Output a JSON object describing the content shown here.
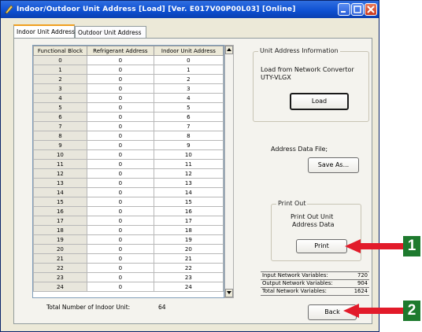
{
  "window": {
    "title": "Indoor/Outdoor Unit Address   [Load] [Ver. E017V00P00L03] [Online]"
  },
  "tabs": [
    {
      "label": "Indoor Unit Address"
    },
    {
      "label": "Outdoor Unit Address"
    }
  ],
  "table": {
    "headers": [
      "Functional Block",
      "Refrigerant Address",
      "Indoor Unit Address"
    ],
    "rows": [
      [
        "0",
        "0",
        "0"
      ],
      [
        "1",
        "0",
        "1"
      ],
      [
        "2",
        "0",
        "2"
      ],
      [
        "3",
        "0",
        "3"
      ],
      [
        "4",
        "0",
        "4"
      ],
      [
        "5",
        "0",
        "5"
      ],
      [
        "6",
        "0",
        "6"
      ],
      [
        "7",
        "0",
        "7"
      ],
      [
        "8",
        "0",
        "8"
      ],
      [
        "9",
        "0",
        "9"
      ],
      [
        "10",
        "0",
        "10"
      ],
      [
        "11",
        "0",
        "11"
      ],
      [
        "12",
        "0",
        "12"
      ],
      [
        "13",
        "0",
        "13"
      ],
      [
        "14",
        "0",
        "14"
      ],
      [
        "15",
        "0",
        "15"
      ],
      [
        "16",
        "0",
        "16"
      ],
      [
        "17",
        "0",
        "17"
      ],
      [
        "18",
        "0",
        "18"
      ],
      [
        "19",
        "0",
        "19"
      ],
      [
        "20",
        "0",
        "20"
      ],
      [
        "21",
        "0",
        "21"
      ],
      [
        "22",
        "0",
        "22"
      ],
      [
        "23",
        "0",
        "23"
      ],
      [
        "24",
        "0",
        "24"
      ]
    ]
  },
  "total": {
    "label": "Total Number of Indoor Unit:",
    "value": "64"
  },
  "unit_address_info": {
    "legend": "Unit Address Information",
    "line1": "Load from Network Convertor",
    "line2": "UTY-VLGX",
    "load_label": "Load"
  },
  "address_file": {
    "label": "Address Data File;",
    "save_label": "Save As..."
  },
  "print_out": {
    "legend": "Print Out",
    "line1": "Print Out Unit",
    "line2": "Address Data",
    "print_label": "Print"
  },
  "network_vars": [
    {
      "label": "Input Network Variables:",
      "value": "720"
    },
    {
      "label": "Output Network Variables:",
      "value": "904"
    },
    {
      "label": "Total Network Variables:",
      "value": "1624"
    }
  ],
  "back_label": "Back",
  "callouts": {
    "one": "1",
    "two": "2"
  },
  "colors": {
    "callout": "#1e7a2e",
    "arrow": "#e21b2a",
    "titlebar": "#0d4fd1"
  }
}
